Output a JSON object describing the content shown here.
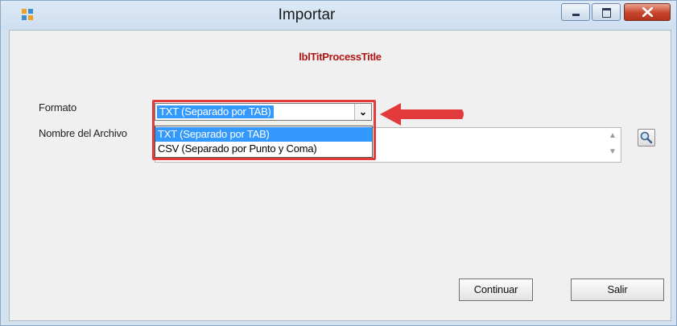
{
  "window": {
    "title": "Importar"
  },
  "form": {
    "process_title": "lblTitProcessTitle",
    "format_label": "Formato",
    "filename_label": "Nombre del Archivo",
    "format_selected": "TXT (Separado por TAB)",
    "format_options": [
      "TXT (Separado por TAB)",
      "CSV (Separado por Punto y Coma)"
    ],
    "filename_value": ""
  },
  "buttons": {
    "continue_label": "Continuar",
    "exit_label": "Salir"
  },
  "icons": {
    "app": "app-window-icon",
    "minimize": "minimize-icon",
    "maximize": "maximize-icon",
    "close": "close-icon",
    "combo_arrow": "chevron-down-icon",
    "browse": "magnifier-icon",
    "annotation": "red-arrow-icon"
  },
  "colors": {
    "title_red": "#b01515",
    "selection_blue": "#3399ff",
    "annotation_red": "#e23a3a"
  }
}
